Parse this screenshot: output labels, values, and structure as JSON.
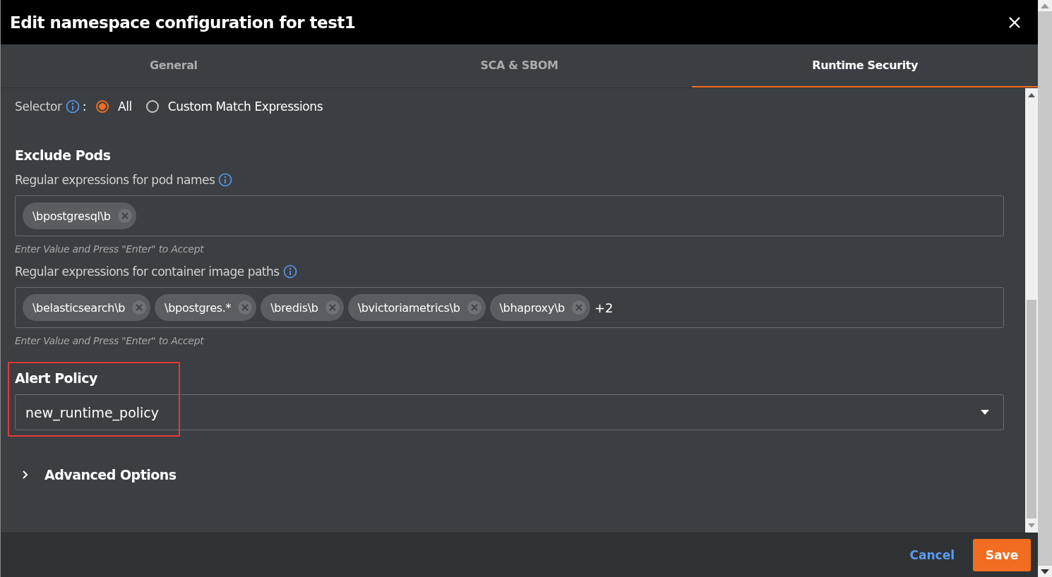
{
  "dialog": {
    "title": "Edit namespace configuration for test1"
  },
  "tabs": [
    {
      "label": "General",
      "selected": false
    },
    {
      "label": "SCA & SBOM",
      "selected": false
    },
    {
      "label": "Runtime Security",
      "selected": true
    }
  ],
  "selector": {
    "label": "Selector",
    "separator": ":",
    "options": [
      {
        "label": "All",
        "selected": true
      },
      {
        "label": "Custom Match Expressions",
        "selected": false
      }
    ]
  },
  "exclude_pods": {
    "heading": "Exclude Pods",
    "fields": [
      {
        "label": "Regular expressions for pod names",
        "tags": [
          "\\bpostgresql\\b"
        ],
        "hint": "Enter Value and Press \"Enter\" to Accept"
      },
      {
        "label": "Regular expressions for container image paths",
        "tags": [
          "\\belasticsearch\\b",
          "\\bpostgres.*",
          "\\bredis\\b",
          "\\bvictoriametrics\\b",
          "\\bhaproxy\\b"
        ],
        "more": "+2",
        "hint": "Enter Value and Press \"Enter\" to Accept"
      }
    ]
  },
  "alert_policy": {
    "heading": "Alert Policy",
    "value": "new_runtime_policy",
    "highlighted": true
  },
  "advanced_options": {
    "label": "Advanced Options",
    "expanded": false
  },
  "buttons": {
    "cancel": "Cancel",
    "save": "Save"
  }
}
